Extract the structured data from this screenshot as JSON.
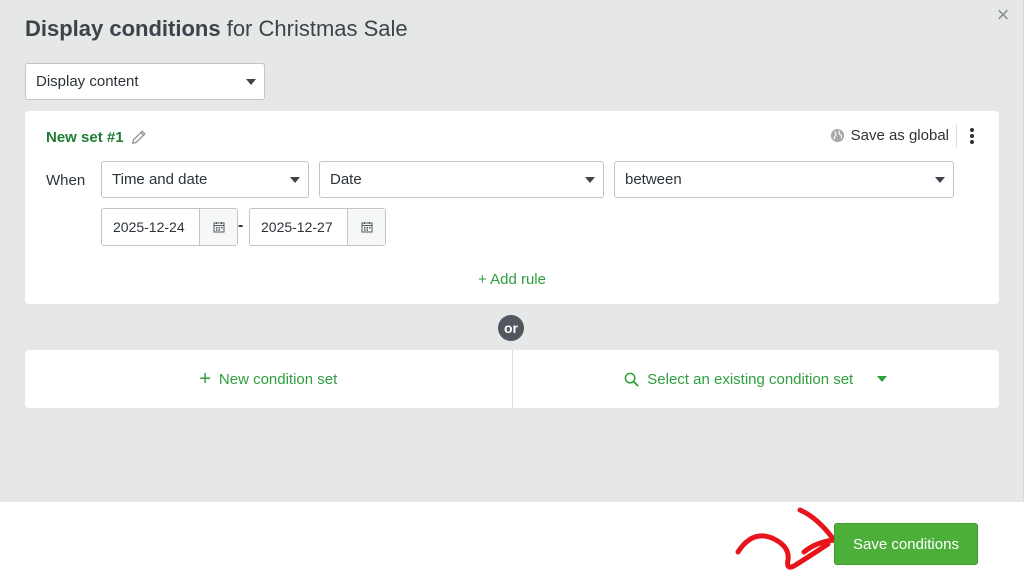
{
  "modal": {
    "title_bold": "Display conditions",
    "title_rest": " for Christmas Sale",
    "close_label": "×"
  },
  "display_select": {
    "value": "Display content"
  },
  "condition_set": {
    "name": "New set #1",
    "save_as_global": "Save as global",
    "when_label": "When",
    "rule": {
      "field": "Time and date",
      "subfield": "Date",
      "operator": "between",
      "date_from": "2025-12-24",
      "date_separator": "-",
      "date_to": "2025-12-27"
    },
    "add_rule": "+ Add rule"
  },
  "or_label": "or",
  "actions": {
    "new_condition_set": "New condition set",
    "select_existing": "Select an existing condition set"
  },
  "footer": {
    "save_button": "Save conditions"
  },
  "colors": {
    "accent_green": "#2e9e3e",
    "button_green": "#4caf3a",
    "arrow_red": "#e8141c"
  },
  "icons": [
    "close-icon",
    "pencil-icon",
    "globe-icon",
    "kebab-menu-icon",
    "calendar-icon",
    "plus-icon",
    "search-icon",
    "chevron-down-icon",
    "arrow-annotation"
  ]
}
